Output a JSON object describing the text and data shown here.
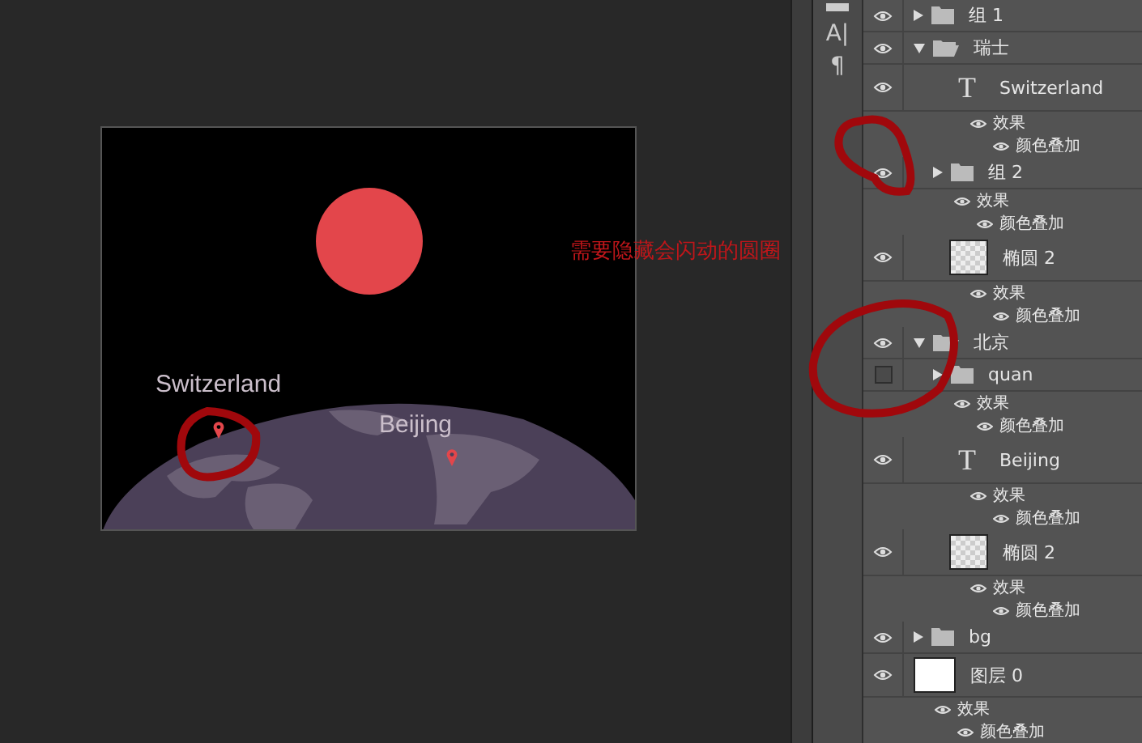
{
  "annotation": "需要隐藏会闪动的圆圈",
  "canvas": {
    "labels": [
      {
        "text": "Switzerland"
      },
      {
        "text": "Beijing"
      }
    ]
  },
  "tool_icons": [
    "A|",
    "¶"
  ],
  "layers": [
    {
      "name": "组 1",
      "kind": "group",
      "visible": true,
      "expanded": false
    },
    {
      "name": "瑞士",
      "kind": "group",
      "visible": true,
      "expanded": true,
      "children": [
        {
          "name": "Switzerland",
          "kind": "text",
          "glyph": "T",
          "visible": true,
          "effects": {
            "label": "效果",
            "items": [
              "颜色叠加"
            ]
          }
        },
        {
          "name": "组 2",
          "kind": "group",
          "visible": true,
          "expanded": false,
          "effects": {
            "label": "效果",
            "items": [
              "颜色叠加"
            ]
          }
        },
        {
          "name": "椭圆 2",
          "kind": "shape",
          "visible": true,
          "effects": {
            "label": "效果",
            "items": [
              "颜色叠加"
            ]
          }
        }
      ]
    },
    {
      "name": "北京",
      "kind": "group",
      "visible": true,
      "expanded": true,
      "children": [
        {
          "name": "quan",
          "kind": "group",
          "visible": false,
          "expanded": false,
          "effects": {
            "label": "效果",
            "items": [
              "颜色叠加"
            ]
          }
        },
        {
          "name": "Beijing",
          "kind": "text",
          "glyph": "T",
          "visible": true,
          "effects": {
            "label": "效果",
            "items": [
              "颜色叠加"
            ]
          }
        },
        {
          "name": "椭圆 2",
          "kind": "shape",
          "visible": true,
          "effects": {
            "label": "效果",
            "items": [
              "颜色叠加"
            ]
          }
        }
      ]
    },
    {
      "name": "bg",
      "kind": "group",
      "visible": true,
      "expanded": false
    },
    {
      "name": "图层 0",
      "kind": "pixel",
      "visible": true,
      "effects": {
        "label": "效果",
        "items": [
          "颜色叠加"
        ]
      }
    }
  ]
}
